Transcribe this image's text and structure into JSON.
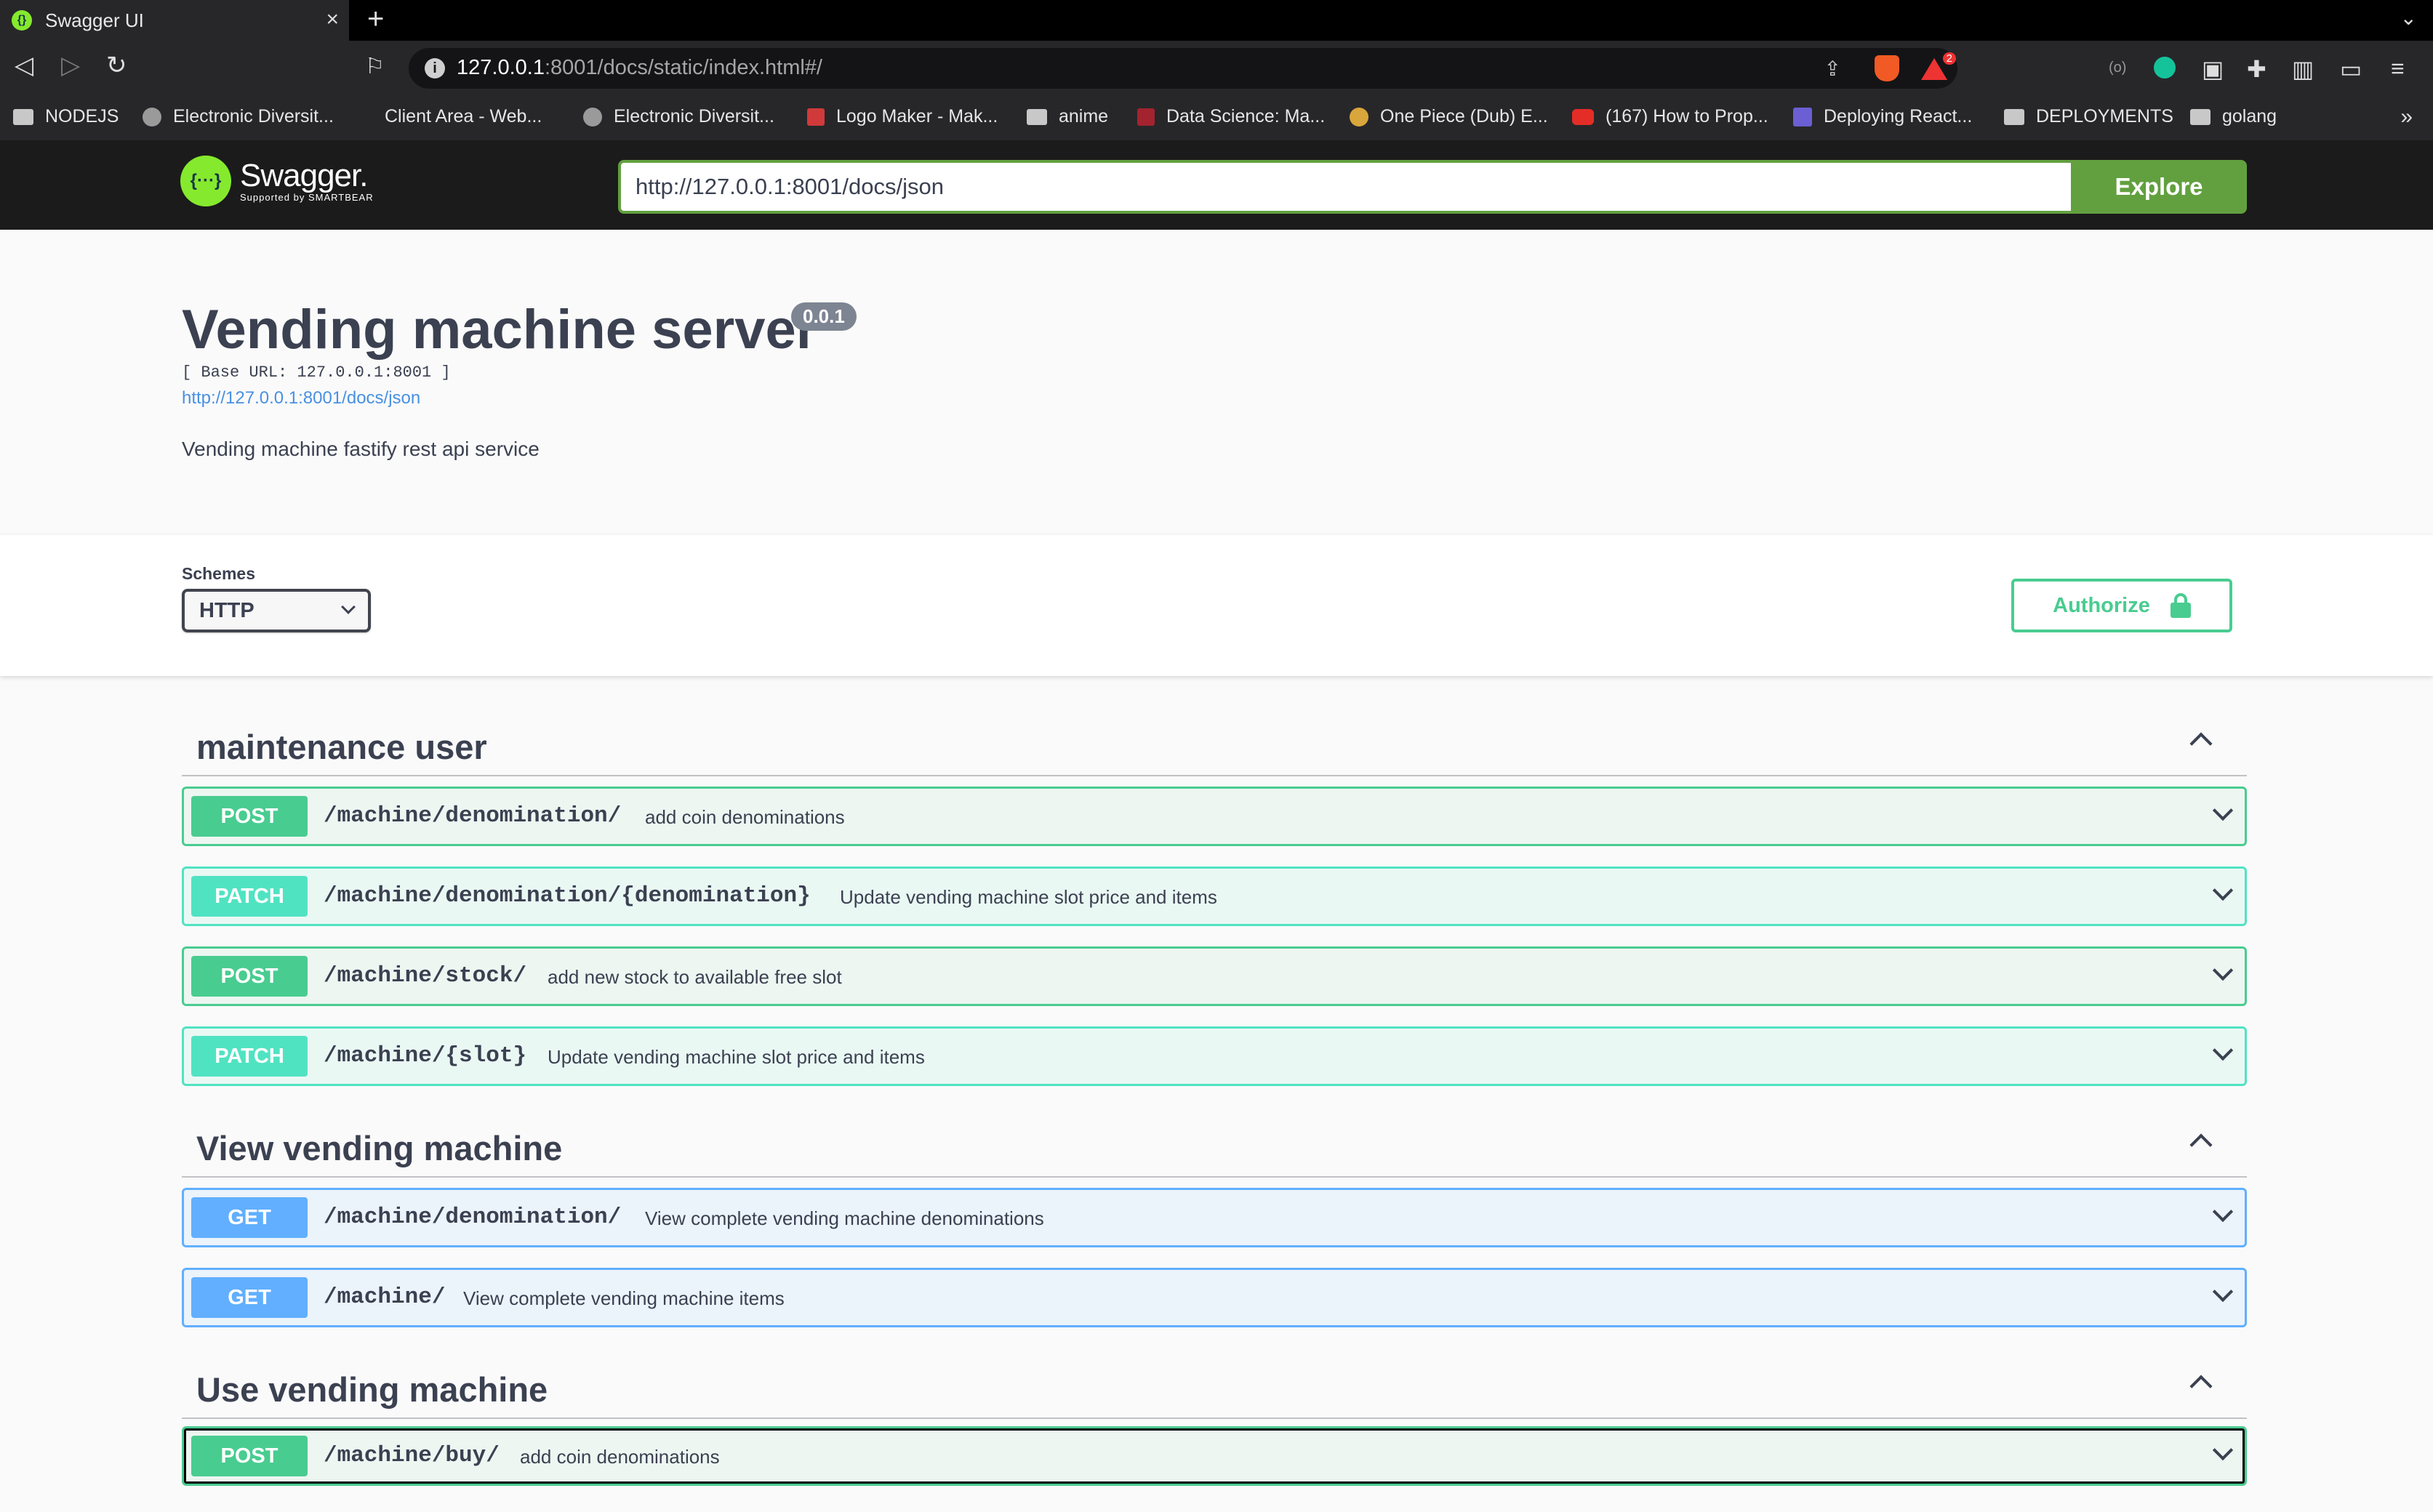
{
  "browser": {
    "tab_title": "Swagger UI",
    "url_host": "127.0.0.1",
    "url_rest": ":8001/docs/static/index.html#/",
    "bookmarks": [
      "NODEJS",
      "Electronic Diversit...",
      "Client Area - Web...",
      "Electronic Diversit...",
      "Logo Maker - Mak...",
      "anime",
      "Data Science: Ma...",
      "One Piece (Dub) E...",
      "(167) How to Prop...",
      "Deploying React...",
      "DEPLOYMENTS",
      "golang"
    ],
    "bookmarks_more": "»",
    "brave_badge": "2"
  },
  "topbar": {
    "brand": "Swagger.",
    "brand_sub": "Supported by SMARTBEAR",
    "spec_url": "http://127.0.0.1:8001/docs/json",
    "explore_label": "Explore"
  },
  "info": {
    "title": "Vending machine server",
    "version": "0.0.1",
    "base_url": "[ Base URL: 127.0.0.1:8001 ]",
    "spec_link": "http://127.0.0.1:8001/docs/json",
    "description": "Vending machine fastify rest api service"
  },
  "schemes": {
    "label": "Schemes",
    "selected": "HTTP",
    "authorize_label": "Authorize"
  },
  "tags": [
    {
      "name": "maintenance user",
      "operations": [
        {
          "method": "POST",
          "path": "/machine/denomination/",
          "summary": "add coin denominations"
        },
        {
          "method": "PATCH",
          "path": "/machine/denomination/{denomination}",
          "summary": "Update vending machine slot price and items"
        },
        {
          "method": "POST",
          "path": "/machine/stock/",
          "summary": "add new stock to available free slot"
        },
        {
          "method": "PATCH",
          "path": "/machine/{slot}",
          "summary": "Update vending machine slot price and items"
        }
      ]
    },
    {
      "name": "View vending machine",
      "operations": [
        {
          "method": "GET",
          "path": "/machine/denomination/",
          "summary": "View complete vending machine denominations"
        },
        {
          "method": "GET",
          "path": "/machine/",
          "summary": "View complete vending machine items"
        }
      ]
    },
    {
      "name": "Use vending machine",
      "operations": [
        {
          "method": "POST",
          "path": "/machine/buy/",
          "summary": "add coin denominations"
        }
      ]
    }
  ],
  "colors": {
    "post": "#49cc90",
    "patch": "#50e3c2",
    "get": "#61affe",
    "swagger_green": "#85ea2d",
    "explore_green": "#62a03f"
  }
}
